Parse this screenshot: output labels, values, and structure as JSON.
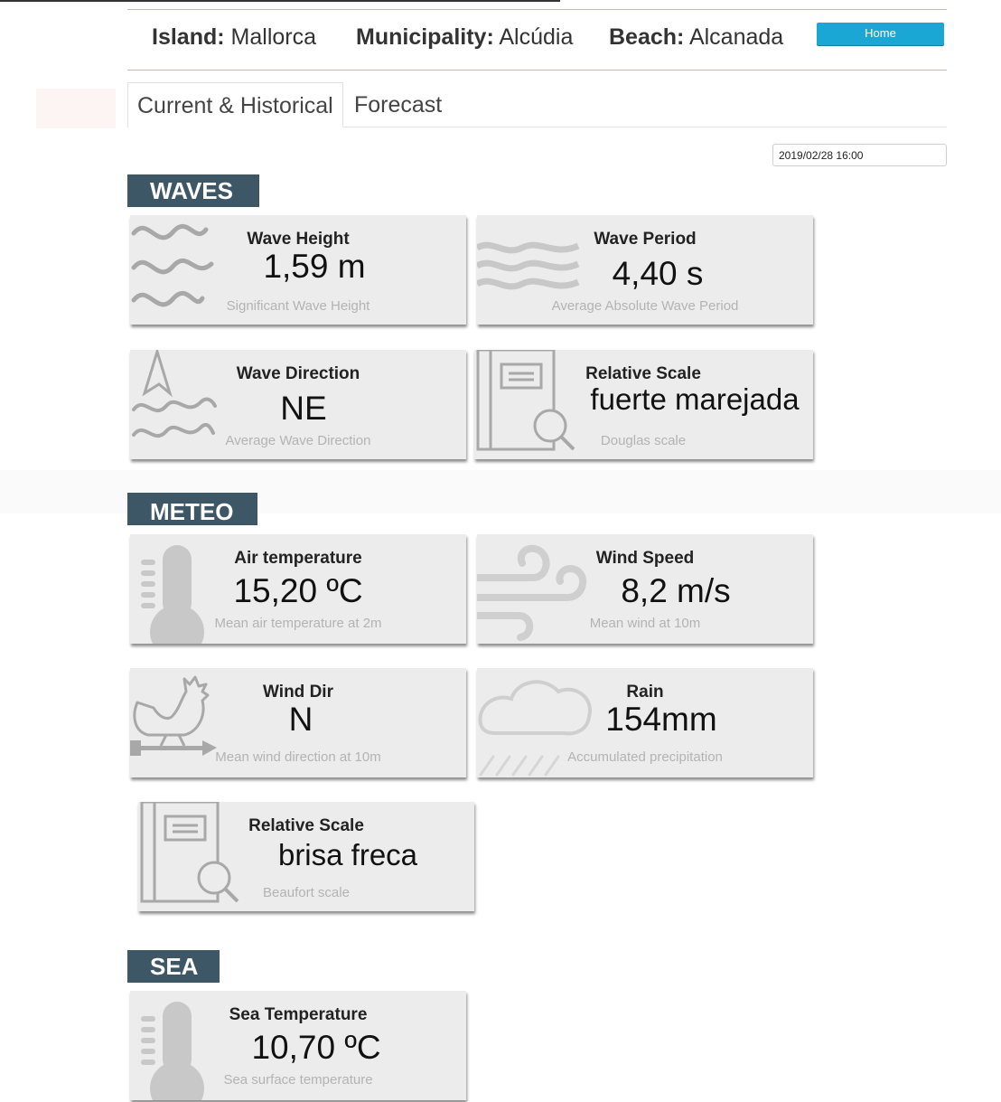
{
  "header": {
    "island_label": "Island:",
    "island_value": "Mallorca",
    "municipality_label": "Municipality:",
    "municipality_value": "Alcúdia",
    "beach_label": "Beach:",
    "beach_value": "Alcanada",
    "home_button": "Home"
  },
  "tabs": [
    {
      "label": "Current & Historical",
      "active": true
    },
    {
      "label": "Forecast",
      "active": false
    }
  ],
  "date_field": {
    "value": "2019/02/28 16:00"
  },
  "sections": {
    "waves": {
      "title": "WAVES",
      "cards": [
        {
          "icon": "waves-icon",
          "title": "Wave Height",
          "value": "1,59 m",
          "subtitle": "Significant Wave Height"
        },
        {
          "icon": "wave-lines-icon",
          "title": "Wave Period",
          "value": "4,40 s",
          "subtitle": "Average Absolute Wave Period"
        },
        {
          "icon": "wave-direction-icon",
          "title": "Wave Direction",
          "value": "NE",
          "subtitle": "Average Wave Direction"
        },
        {
          "icon": "scale-book-icon",
          "title": "Relative Scale",
          "value": "fuerte marejada",
          "subtitle": "Douglas scale"
        }
      ]
    },
    "meteo": {
      "title": "METEO",
      "cards": [
        {
          "icon": "thermometer-icon",
          "title": "Air temperature",
          "value": "15,20 ºC",
          "subtitle": "Mean air temperature at 2m"
        },
        {
          "icon": "wind-icon",
          "title": "Wind Speed",
          "value": "8,2 m/s",
          "subtitle": "Mean wind at 10m"
        },
        {
          "icon": "weathervane-rooster-icon",
          "title": "Wind Dir",
          "value": "N",
          "subtitle": "Mean wind direction at 10m"
        },
        {
          "icon": "rain-cloud-icon",
          "title": "Rain",
          "value": "154mm",
          "subtitle": "Accumulated precipitation"
        },
        {
          "icon": "scale-book-icon",
          "title": "Relative Scale",
          "value": "brisa freca",
          "subtitle": "Beaufort scale"
        }
      ]
    },
    "sea": {
      "title": "SEA",
      "cards": [
        {
          "icon": "thermometer-icon",
          "title": "Sea Temperature",
          "value": "10,70 ºC",
          "subtitle": "Sea surface temperature"
        }
      ]
    }
  },
  "colors": {
    "section_header_bg": "#3e5766",
    "home_button_bg": "#1aa7d4",
    "card_bg": "#ececec",
    "icon_gray": "#a8a8a8",
    "subtitle_gray": "#b3b3b3"
  }
}
